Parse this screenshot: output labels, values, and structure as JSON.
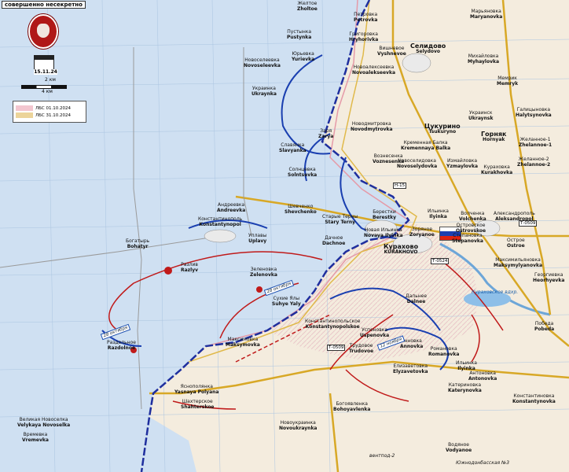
{
  "header": {
    "title": "совершенно несекретно"
  },
  "map_date": "15.11.24",
  "scale": {
    "label_top": "2 км",
    "label_bottom": "4 км"
  },
  "legend": [
    {
      "label": "ЛБС 01.10.2024",
      "color": "#f3c6cf"
    },
    {
      "label": "ЛБС 31.10.2024",
      "color": "#ecd49a"
    }
  ],
  "colors": {
    "ua_zone": "#cfe0f2",
    "ru_zone": "#f4ecde",
    "ru_front": "#1f2f9e",
    "arrow_blue": "#1a3fb0",
    "arrow_red": "#c01a1a",
    "road_major": "#d8a826",
    "road_minor": "#9a9a9a"
  },
  "places": [
    {
      "ru": "Желтое",
      "en": "Zholtoe"
    },
    {
      "ru": "Петровка",
      "en": "Petrovka"
    },
    {
      "ru": "Пустынка",
      "en": "Pustynka"
    },
    {
      "ru": "Григоровка",
      "en": "Hryhorivka"
    },
    {
      "ru": "Вишневое",
      "en": "Vyshnevoe"
    },
    {
      "ru": "Селидово",
      "en": "Selydovo"
    },
    {
      "ru": "Марьяновка",
      "en": "Maryanovka"
    },
    {
      "ru": "Юрьевка",
      "en": "Yurievka"
    },
    {
      "ru": "Новоалексеевка",
      "en": "Novoalekseevka"
    },
    {
      "ru": "Новоселеевка",
      "en": "Novoseleevka"
    },
    {
      "ru": "Михайловка",
      "en": "Myhaylovka"
    },
    {
      "ru": "Мемрик",
      "en": "Memryk"
    },
    {
      "ru": "Украинка",
      "en": "Ukraynka"
    },
    {
      "ru": "Украинск",
      "en": "Ukraynsk"
    },
    {
      "ru": "Галицыновка",
      "en": "Halytsynovka"
    },
    {
      "ru": "Цукурино",
      "en": "Tsukuryno"
    },
    {
      "ru": "Новодмитровка",
      "en": "Novodmytrovka"
    },
    {
      "ru": "Заря",
      "en": "Zarya"
    },
    {
      "ru": "Горняк",
      "en": "Hornyak"
    },
    {
      "ru": "Желанное-1",
      "en": "Zhelannoe-1"
    },
    {
      "ru": "Желанное-2",
      "en": "Zhelannoe-2"
    },
    {
      "ru": "Кременная Балка",
      "en": "Kremennaya Balka"
    },
    {
      "ru": "Славянка",
      "en": "Slavyanka"
    },
    {
      "ru": "Вознесенка",
      "en": "Voznesenka"
    },
    {
      "ru": "Новоселидовка",
      "en": "Novoselydovka"
    },
    {
      "ru": "Измайловка",
      "en": "Yzmaylovka"
    },
    {
      "ru": "Кураховка",
      "en": "Kurakhovka"
    },
    {
      "ru": "Солнцевка",
      "en": "Solntsevka"
    },
    {
      "ru": "Андреевка",
      "en": "Andreevka"
    },
    {
      "ru": "Шевченко",
      "en": "Shevchenko"
    },
    {
      "ru": "Старые Терны",
      "en": "Stary Terny"
    },
    {
      "ru": "Берестки",
      "en": "Berestky"
    },
    {
      "ru": "Ильинка",
      "en": "Ilyinka"
    },
    {
      "ru": "Волченка",
      "en": "Volchenka"
    },
    {
      "ru": "Александрополь",
      "en": "Aleksandropol"
    },
    {
      "ru": "Островское",
      "en": "Ostrovskoe"
    },
    {
      "ru": "Константинополь",
      "en": "Konstantynopol"
    },
    {
      "ru": "Уплавы",
      "en": "Uplavy"
    },
    {
      "ru": "Дачное",
      "en": "Dachnoe"
    },
    {
      "ru": "Новая Ильинка",
      "en": "Novaya Ilyinka"
    },
    {
      "ru": "Зоряное",
      "en": "Zoryanoe"
    },
    {
      "ru": "Степановка",
      "en": "Stepanovka"
    },
    {
      "ru": "Острое",
      "en": "Ostroe"
    },
    {
      "ru": "Богатырь",
      "en": "Bohatyr"
    },
    {
      "ru": "Курахово",
      "en": "KURAKHOVO"
    },
    {
      "ru": "Максимильяновка",
      "en": "Maksymylyanovka"
    },
    {
      "ru": "Разлив",
      "en": "Razlyv"
    },
    {
      "ru": "Зеленовка",
      "en": "Zelenovka"
    },
    {
      "ru": "Георгиевка",
      "en": "Heorhyevka"
    },
    {
      "ru": "Сухие Ялы",
      "en": "Suhye Yaly"
    },
    {
      "ru": "Дальнее",
      "en": "Dalnee"
    },
    {
      "ru": "Константинопольское",
      "en": "Konstantynopolskoe"
    },
    {
      "ru": "Победа",
      "en": "Pobeda"
    },
    {
      "ru": "Раздольное",
      "en": "Razdolnoe"
    },
    {
      "ru": "Максимовка",
      "en": "Maksymovka"
    },
    {
      "ru": "Успеновка",
      "en": "Uspenovka"
    },
    {
      "ru": "Анновка",
      "en": "Annovka"
    },
    {
      "ru": "Трудовое",
      "en": "Trudovoe"
    },
    {
      "ru": "Романовка",
      "en": "Romanovka"
    },
    {
      "ru": "Елизаветовка",
      "en": "Elyzavetovka"
    },
    {
      "ru": "Ильинка",
      "en": "Ilyinka"
    },
    {
      "ru": "Яснополянка",
      "en": "Yasnaya Polyana"
    },
    {
      "ru": "Катериновка",
      "en": "Katerynovka"
    },
    {
      "ru": "Антоновка",
      "en": "Antonovka"
    },
    {
      "ru": "Шахтерское",
      "en": "Shahterskoe"
    },
    {
      "ru": "Богоявленка",
      "en": "Bohoyavlenka"
    },
    {
      "ru": "Константиновка",
      "en": "Konstantynovka"
    },
    {
      "ru": "Великая Новоселка",
      "en": "Velykaya Novoselka"
    },
    {
      "ru": "Новоукраинка",
      "en": "Novoukraynka"
    },
    {
      "ru": "Времевка",
      "en": "Vremevka"
    },
    {
      "ru": "Водяное",
      "en": "Vodyanoe"
    }
  ],
  "date_flags": [
    "28 октября",
    "28 октября",
    "12 ноября"
  ],
  "road_labels": [
    "Т-0509",
    "Т-0524",
    "Н-15",
    "Т-0509",
    "вентпод-2",
    "Южнодонбасская №3"
  ],
  "waterbody": "Кураховское вдхр."
}
